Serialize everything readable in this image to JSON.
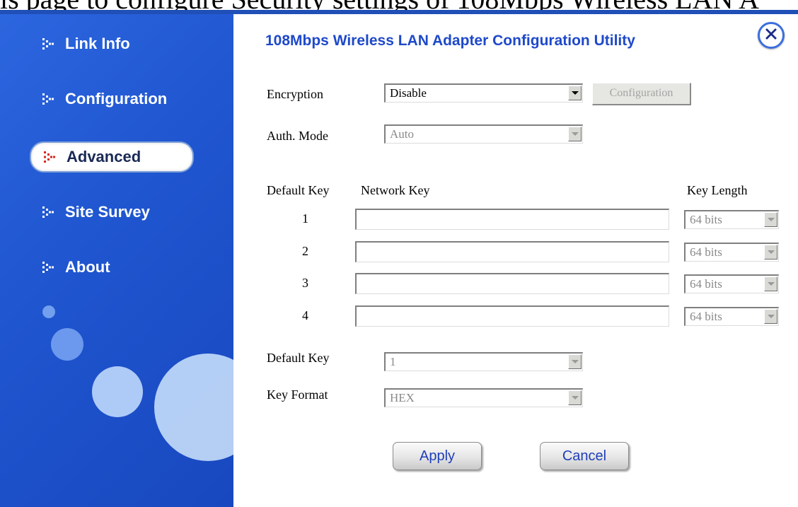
{
  "caption": "is page to configure Security settings of 108Mbps Wireless LAN A",
  "colors": {
    "sidebar": "#1f55cf",
    "title": "#1e49c9",
    "button_text": "#1e3fb8",
    "active_icon": "#d9281c"
  },
  "sidebar": {
    "items": [
      {
        "label": "Link Info",
        "icon": "dots-arrow-icon",
        "active": false
      },
      {
        "label": "Configuration",
        "icon": "dots-arrow-icon",
        "active": false
      },
      {
        "label": "Advanced",
        "icon": "dots-arrow-icon",
        "active": true
      },
      {
        "label": "Site Survey",
        "icon": "dots-arrow-icon",
        "active": false
      },
      {
        "label": "About",
        "icon": "dots-arrow-icon",
        "active": false
      }
    ]
  },
  "header": {
    "title": "108Mbps Wireless LAN Adapter Configuration Utility",
    "close_icon": "close-icon"
  },
  "form": {
    "encryption": {
      "label": "Encryption",
      "value": "Disable",
      "button_label": "Configuration"
    },
    "auth_mode": {
      "label": "Auth. Mode",
      "value": "Auto"
    },
    "keys_header": {
      "default_key": "Default Key",
      "network_key": "Network Key",
      "key_length": "Key Length"
    },
    "keys": [
      {
        "index": "1",
        "value": "",
        "length": "64 bits"
      },
      {
        "index": "2",
        "value": "",
        "length": "64 bits"
      },
      {
        "index": "3",
        "value": "",
        "length": "64 bits"
      },
      {
        "index": "4",
        "value": "",
        "length": "64 bits"
      }
    ],
    "default_key": {
      "label": "Default Key",
      "value": "1"
    },
    "key_format": {
      "label": "Key Format",
      "value": "HEX"
    }
  },
  "actions": {
    "apply": "Apply",
    "cancel": "Cancel"
  }
}
